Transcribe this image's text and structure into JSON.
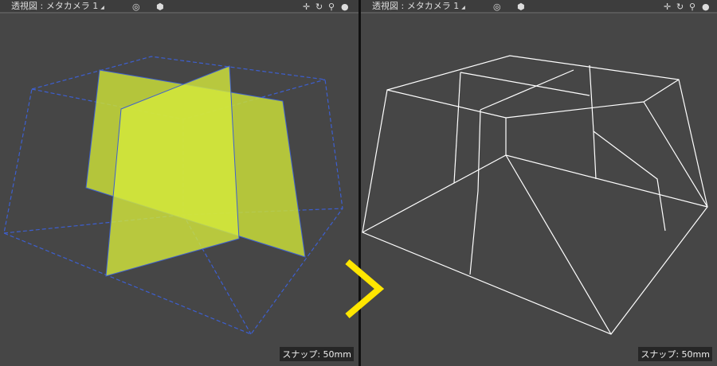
{
  "viewports": [
    {
      "title": "透視図 : メタカメラ 1",
      "snap": "スナップ: 50mm"
    },
    {
      "title": "透視図 : メタカメラ 1",
      "snap": "スナップ: 50mm"
    }
  ],
  "colors": {
    "plane": "#d4e83c",
    "wire_left": "#3d5fd0",
    "wire_right": "#ffffff",
    "arrow": "#ffe600"
  }
}
